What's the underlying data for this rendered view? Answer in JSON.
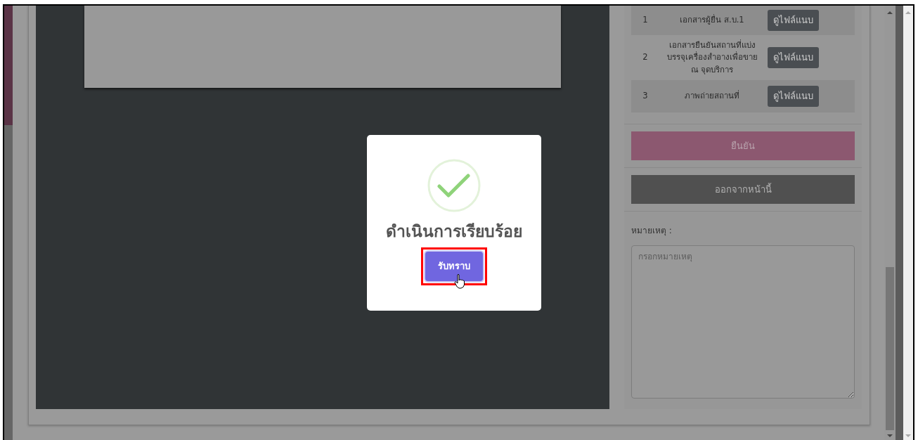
{
  "documents": [
    {
      "number": "1",
      "name": "เอกสารผู้ยื่น ส.บ.1",
      "button": "ดูไฟล์แนบ"
    },
    {
      "number": "2",
      "name": "เอกสารยืนยันสถานที่แบ่งบรรจุเครื่องสำอางเพื่อขาย ณ จุดบริการ",
      "button": "ดูไฟล์แนบ"
    },
    {
      "number": "3",
      "name": "ภาพถ่ายสถานที่",
      "button": "ดูไฟล์แนบ"
    }
  ],
  "confirm_button": "ยืนยัน",
  "exit_button": "ออกจากหน้านี้",
  "remark": {
    "label": "หมายเหตุ :",
    "placeholder": "กรอกหมายเหตุ"
  },
  "dialog": {
    "title": "ดำเนินการเรียบร้อย",
    "button": {
      "label": "รับทราบ",
      "highlighted": true
    }
  }
}
